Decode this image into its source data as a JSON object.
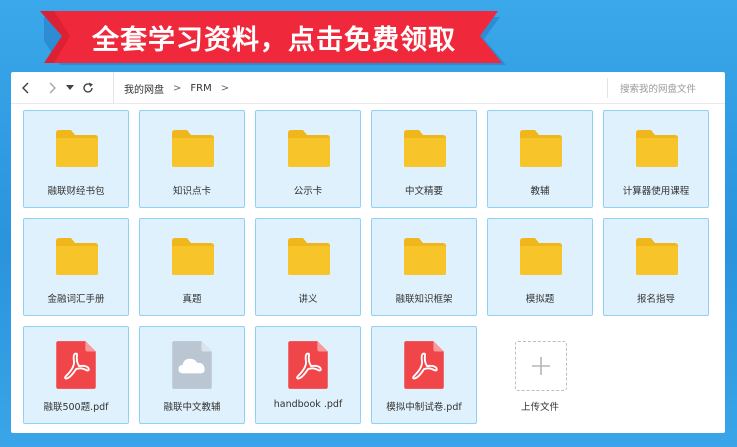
{
  "banner": {
    "text": "全套学习资料，点击免费领取"
  },
  "nav": {
    "back": "‹",
    "forward": "›",
    "dropdown": "▾",
    "refresh": "⟳"
  },
  "breadcrumb": {
    "root": "我的网盘",
    "sep": ">",
    "current": "FRM",
    "sep2": ">"
  },
  "search": {
    "placeholder": "搜索我的网盘文件"
  },
  "items": [
    {
      "label": "融联财经书包",
      "type": "folder"
    },
    {
      "label": "知识点卡",
      "type": "folder"
    },
    {
      "label": "公示卡",
      "type": "folder"
    },
    {
      "label": "中文精要",
      "type": "folder"
    },
    {
      "label": "教辅",
      "type": "folder"
    },
    {
      "label": "计算器使用课程",
      "type": "folder"
    },
    {
      "label": "金融词汇手册",
      "type": "folder"
    },
    {
      "label": "真题",
      "type": "folder"
    },
    {
      "label": "讲义",
      "type": "folder"
    },
    {
      "label": "融联知识框架",
      "type": "folder"
    },
    {
      "label": "模拟题",
      "type": "folder"
    },
    {
      "label": "报名指导",
      "type": "folder"
    },
    {
      "label": "融联500题.pdf",
      "type": "pdf"
    },
    {
      "label": "融联中文教辅",
      "type": "cloud"
    },
    {
      "label": "handbook .pdf",
      "type": "pdf"
    },
    {
      "label": "模拟中制试卷.pdf",
      "type": "pdf"
    },
    {
      "label": "上传文件",
      "type": "upload"
    }
  ],
  "colors": {
    "banner": "#f0283c",
    "folder": "#f7c52a",
    "folder_back": "#f0b71c",
    "pdf": "#f0464a",
    "cloud_file": "#bac6d2",
    "tile_bg": "#dff1fc",
    "tile_border": "#8fd2f6"
  }
}
